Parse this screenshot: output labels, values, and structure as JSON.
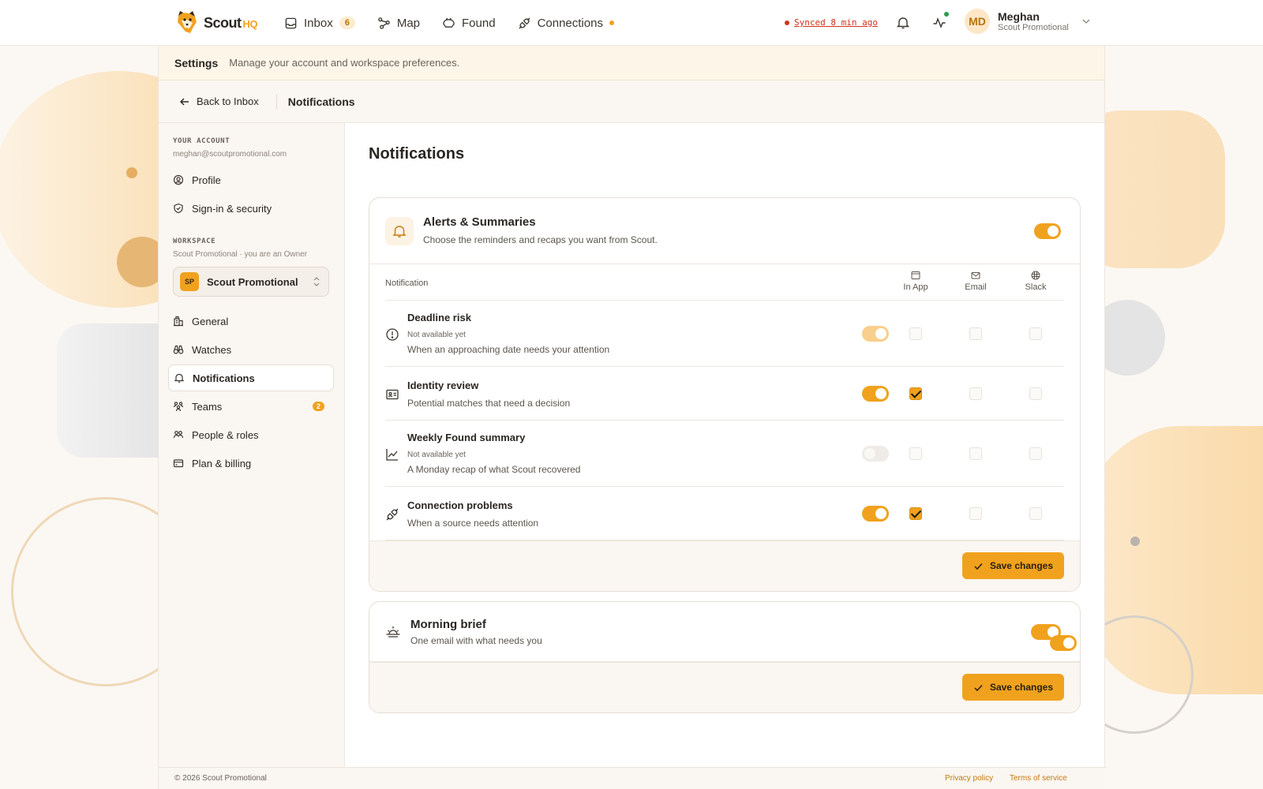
{
  "app": {
    "name": "Scout",
    "name_suffix": "HQ"
  },
  "nav": {
    "items": [
      {
        "label": "Inbox",
        "icon": "inbox-icon",
        "badge": "6"
      },
      {
        "label": "Map",
        "icon": "map-icon"
      },
      {
        "label": "Found",
        "icon": "found-icon"
      },
      {
        "label": "Connections",
        "icon": "plug-icon",
        "status_dot": true
      }
    ]
  },
  "sync": {
    "text": "Synced 8 min ago",
    "color": "#d0321d"
  },
  "user": {
    "initials": "MD",
    "name": "Meghan",
    "org": "Scout Promotional"
  },
  "settings": {
    "title": "Settings",
    "subtitle": "Manage your account and workspace preferences."
  },
  "breadcrumb": {
    "back": "Back to Inbox",
    "current": "Notifications"
  },
  "sidebar": {
    "account_label": "YOUR ACCOUNT",
    "account_email": "meghan@scoutpromotional.com",
    "account_items": [
      {
        "label": "Profile",
        "icon": "user-circle-icon"
      },
      {
        "label": "Sign-in & security",
        "icon": "shield-icon"
      }
    ],
    "workspace_label": "WORKSPACE",
    "workspace_sub": "Scout Promotional · you are an Owner",
    "workspace_select": {
      "logo": "SP",
      "name": "Scout Promotional"
    },
    "workspace_items": [
      {
        "label": "General",
        "icon": "building-icon"
      },
      {
        "label": "Watches",
        "icon": "binoculars-icon"
      },
      {
        "label": "Notifications",
        "icon": "bell-icon",
        "active": true
      },
      {
        "label": "Teams",
        "icon": "teams-icon",
        "badge": "2"
      },
      {
        "label": "People & roles",
        "icon": "people-icon"
      },
      {
        "label": "Plan & billing",
        "icon": "card-icon"
      }
    ]
  },
  "main": {
    "title": "Notifications",
    "alerts": {
      "title": "Alerts & Summaries",
      "description": "Choose the reminders and recaps you want from Scout.",
      "enabled": true,
      "columns": {
        "notification": "Notification",
        "in_app": "In App",
        "email": "Email",
        "slack": "Slack"
      },
      "rows": [
        {
          "title": "Deadline risk",
          "note": "Not available yet",
          "description": "When an approaching date needs your attention",
          "icon": "alert-circle-icon",
          "toggle": "dim",
          "in_app": false,
          "email": false,
          "slack": false
        },
        {
          "title": "Identity review",
          "note": "",
          "description": "Potential matches that need a decision",
          "icon": "id-card-icon",
          "toggle": "on",
          "in_app": true,
          "email": false,
          "slack": false
        },
        {
          "title": "Weekly Found summary",
          "note": "Not available yet",
          "description": "A Monday recap of what Scout recovered",
          "icon": "trend-icon",
          "toggle": "off",
          "in_app": false,
          "email": false,
          "slack": false
        },
        {
          "title": "Connection problems",
          "note": "",
          "description": "When a source needs attention",
          "icon": "plug-icon",
          "toggle": "on",
          "in_app": true,
          "email": false,
          "slack": false
        }
      ],
      "save_label": "Save changes"
    },
    "brief": {
      "title": "Morning brief",
      "description": "One email with what needs you",
      "enabled": true,
      "save_label": "Save changes"
    }
  },
  "footer": {
    "copyright": "© 2026 Scout Promotional",
    "privacy": "Privacy policy",
    "terms": "Terms of service"
  },
  "colors": {
    "accent": "#f0a21e",
    "accent_soft": "#fdf5e8"
  }
}
